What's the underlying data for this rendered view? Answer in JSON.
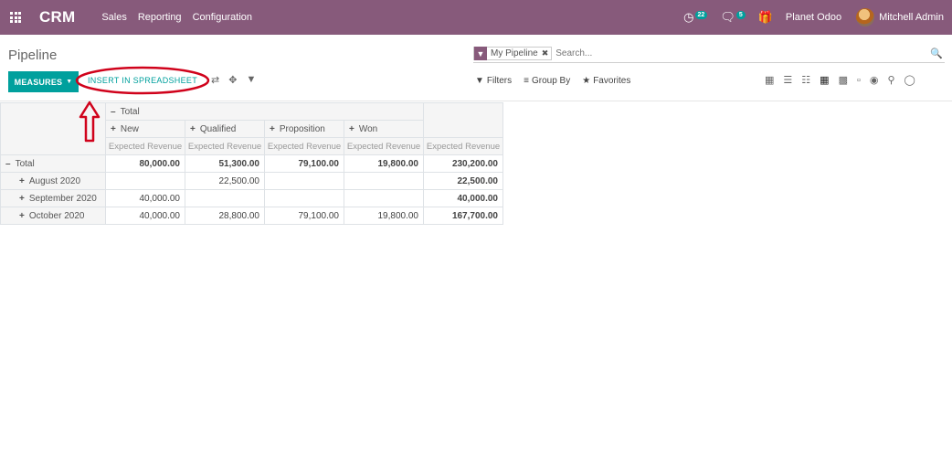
{
  "navbar": {
    "brand": "CRM",
    "menu": [
      "Sales",
      "Reporting",
      "Configuration"
    ],
    "activities_count": "22",
    "messages_count": "5",
    "company": "Planet Odoo",
    "user": "Mitchell Admin",
    "color": "#875a7b"
  },
  "control_panel": {
    "title": "Pipeline",
    "search": {
      "facet": "My Pipeline",
      "placeholder": "Search..."
    },
    "measures_label": "MEASURES",
    "insert_label": "INSERT IN SPREADSHEET",
    "filters_label": "Filters",
    "groupby_label": "Group By",
    "favorites_label": "Favorites",
    "accent": "#00a09d"
  },
  "pivot": {
    "col_total_label": "Total",
    "columns": [
      "New",
      "Qualified",
      "Proposition",
      "Won"
    ],
    "measure_label": "Expected Revenue",
    "rows": [
      {
        "label": "Total",
        "values": [
          "80,000.00",
          "51,300.00",
          "79,100.00",
          "19,800.00"
        ],
        "total": "230,200.00"
      },
      {
        "label": "August 2020",
        "values": [
          "",
          "22,500.00",
          "",
          ""
        ],
        "total": "22,500.00"
      },
      {
        "label": "September 2020",
        "values": [
          "40,000.00",
          "",
          "",
          ""
        ],
        "total": "40,000.00"
      },
      {
        "label": "October 2020",
        "values": [
          "40,000.00",
          "28,800.00",
          "79,100.00",
          "19,800.00"
        ],
        "total": "167,700.00"
      }
    ]
  }
}
